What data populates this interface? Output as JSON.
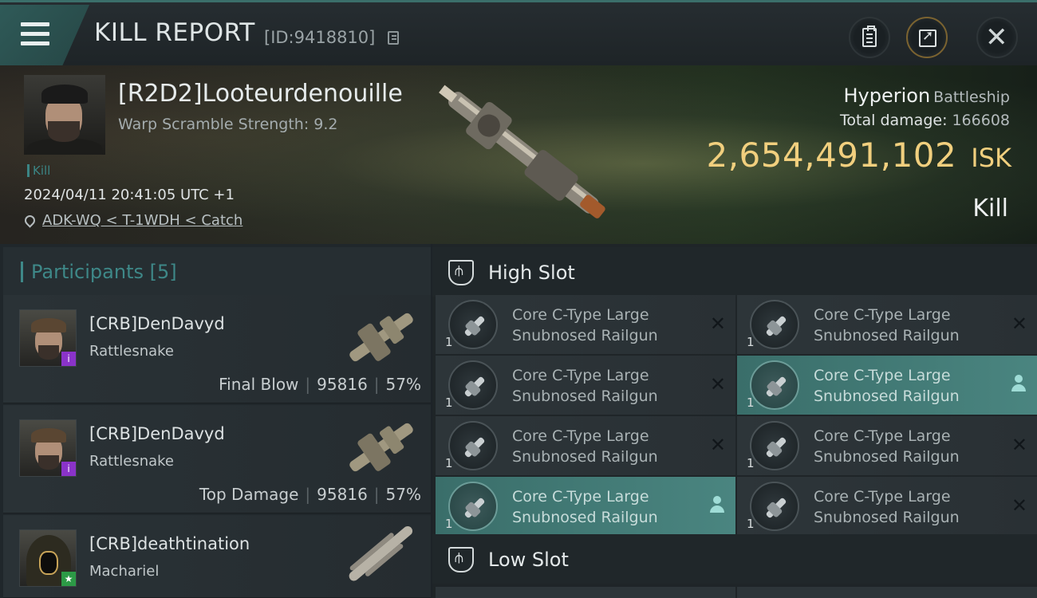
{
  "header": {
    "title": "KILL REPORT",
    "report_id": "[ID:9418810]"
  },
  "victim": {
    "name": "[R2D2]Looteurdenouille",
    "warp_scramble": "Warp Scramble Strength: 9.2",
    "tag": "Kill",
    "datetime": "2024/04/11 20:41:05 UTC +1",
    "location": "ADK-WQ < T-1WDH < Catch",
    "ship_name": "Hyperion",
    "ship_class": "Battleship",
    "total_damage_label": "Total damage:",
    "total_damage": "166608",
    "isk_value": "2,654,491,102",
    "isk_unit": "ISK",
    "result": "Kill"
  },
  "participants": {
    "title": "Participants",
    "count": "[5]",
    "rows": [
      {
        "name": "[CRB]DenDavyd",
        "ship": "Rattlesnake",
        "stat_label": "Final Blow",
        "damage": "95816",
        "percent": "57%",
        "badge": "i"
      },
      {
        "name": "[CRB]DenDavyd",
        "ship": "Rattlesnake",
        "stat_label": "Top Damage",
        "damage": "95816",
        "percent": "57%",
        "badge": "i"
      },
      {
        "name": "[CRB]deathtination",
        "ship": "Machariel",
        "badge": "★"
      }
    ]
  },
  "slots": {
    "high_title": "High Slot",
    "low_title": "Low Slot",
    "high_modules": [
      {
        "line1": "Core C-Type Large",
        "line2": "Snubnosed Railgun",
        "qty": "1",
        "state": "destroyed"
      },
      {
        "line1": "Core C-Type Large",
        "line2": "Snubnosed Railgun",
        "qty": "1",
        "state": "destroyed"
      },
      {
        "line1": "Core C-Type Large",
        "line2": "Snubnosed Railgun",
        "qty": "1",
        "state": "destroyed"
      },
      {
        "line1": "Core C-Type Large",
        "line2": "Snubnosed Railgun",
        "qty": "1",
        "state": "dropped"
      },
      {
        "line1": "Core C-Type Large",
        "line2": "Snubnosed Railgun",
        "qty": "1",
        "state": "destroyed"
      },
      {
        "line1": "Core C-Type Large",
        "line2": "Snubnosed Railgun",
        "qty": "1",
        "state": "destroyed"
      },
      {
        "line1": "Core C-Type Large",
        "line2": "Snubnosed Railgun",
        "qty": "1",
        "state": "dropped"
      },
      {
        "line1": "Core C-Type Large",
        "line2": "Snubnosed Railgun",
        "qty": "1",
        "state": "destroyed"
      }
    ],
    "destroyed_glyph": "✕"
  },
  "colors": {
    "accent": "#3e8888",
    "isk": "#f1cf7e",
    "active_module": "#4a8580",
    "corp_badge": "#8a33c9",
    "ally_badge": "#2c9a46"
  },
  "icons": [
    "menu-icon",
    "copy-icon",
    "clipboard-icon",
    "share-icon",
    "close-icon",
    "location-pin-icon",
    "slot-icon",
    "railgun-icon",
    "user-icon"
  ]
}
